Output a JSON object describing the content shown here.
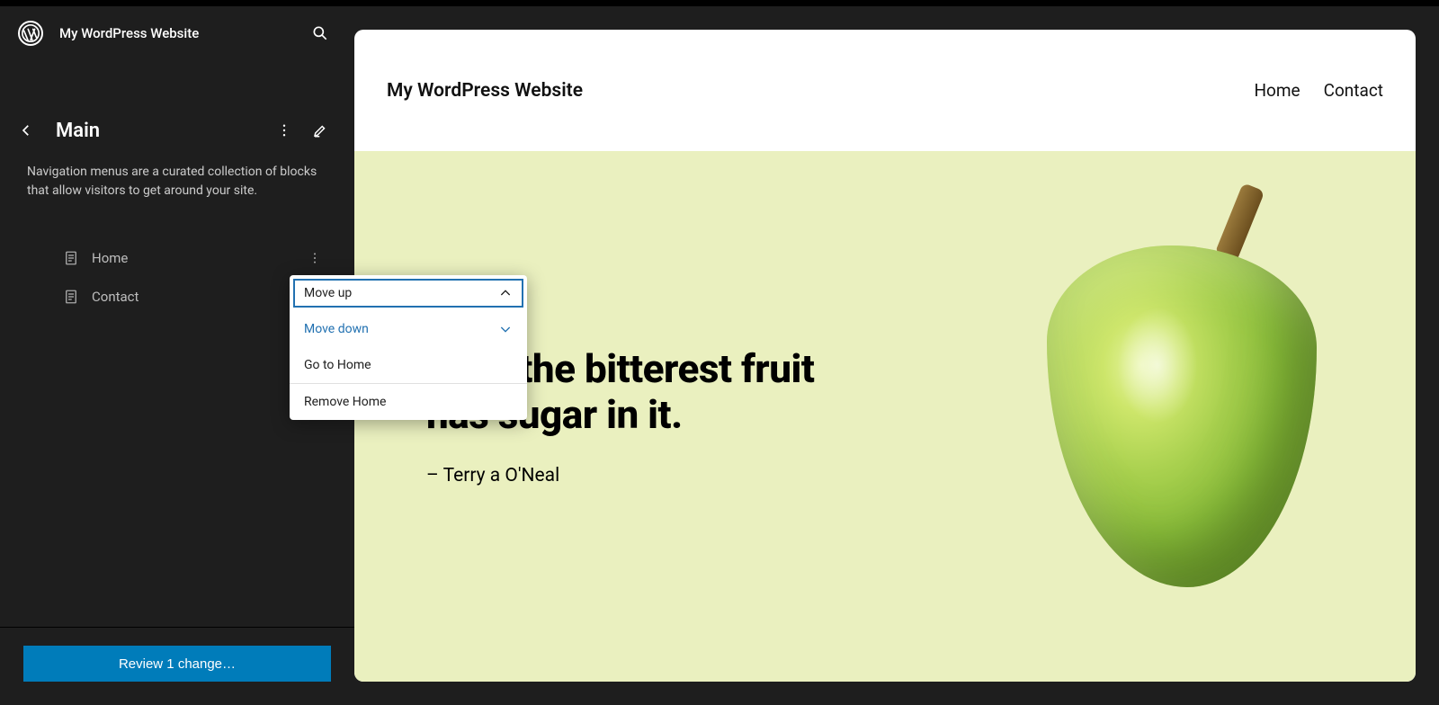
{
  "header": {
    "site_name": "My WordPress Website"
  },
  "sidebar": {
    "title": "Main",
    "description": "Navigation menus are a curated collection of blocks that allow visitors to get around your site.",
    "items": [
      {
        "label": "Home"
      },
      {
        "label": "Contact"
      }
    ],
    "review_button": "Review 1 change…"
  },
  "dropdown": {
    "move_up": "Move up",
    "move_down": "Move down",
    "go_to": "Go to Home",
    "remove": "Remove Home"
  },
  "preview": {
    "site_title": "My WordPress Website",
    "nav": [
      {
        "label": "Home"
      },
      {
        "label": "Contact"
      }
    ],
    "quote_line1": "Even the bitterest fruit",
    "quote_line2": "has sugar in it.",
    "cite": "– Terry a O'Neal"
  }
}
